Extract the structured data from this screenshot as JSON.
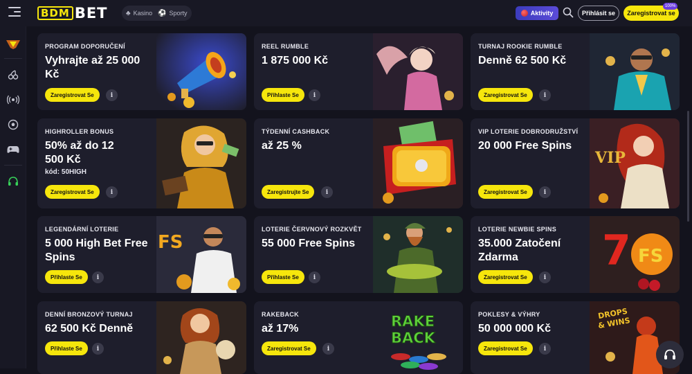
{
  "header": {
    "logo_boxed": "BDM",
    "logo_rest": "BET",
    "modes": [
      {
        "label": "Kasino",
        "icon": "casino-icon"
      },
      {
        "label": "Sporty",
        "icon": "football-icon"
      }
    ],
    "activity_label": "Aktivity",
    "login_label": "Přihlásit se",
    "register_label": "Zaregistrovat se",
    "register_badge": "100%"
  },
  "sidebar": {
    "items": [
      "rank-badge-icon",
      "cherries-icon",
      "live-icon",
      "football-icon",
      "gamepad-icon",
      "headset-icon"
    ]
  },
  "cards": [
    {
      "label": "PROGRAM DOPORUČENÍ",
      "title": "Vyhrajte až 25 000 Kč",
      "cta": "Zaregistrovat Se"
    },
    {
      "label": "REEL RUMBLE",
      "title": "1 875 000 Kč",
      "cta": "Přihlaste Se"
    },
    {
      "label": "TURNAJ ROOKIE RUMBLE",
      "title": "Denně 62 500 Kč",
      "cta": "Zaregistrovat Se"
    },
    {
      "label": "HIGHROLLER BONUS",
      "title": "50% až do 12 500 Kč",
      "code": "kód: 50HIGH",
      "cta": "Zaregistrovat Se"
    },
    {
      "label": "TÝDENNÍ CASHBACK",
      "title": "až 25 %",
      "cta": "Zaregistrujte Se"
    },
    {
      "label": "VIP LOTERIE DOBRODRUŽSTVÍ",
      "title": "20 000 Free Spins",
      "cta": "Zaregistrovat Se"
    },
    {
      "label": "LEGENDÁRNÍ LOTERIE",
      "title": "5 000 High Bet Free Spins",
      "cta": "Přihlaste Se"
    },
    {
      "label": "LOTERIE ČERVNOVÝ ROZKVĚT",
      "title": "55 000 Free Spins",
      "cta": "Přihlaste Se"
    },
    {
      "label": "LOTERIE NEWBIE SPINS",
      "title": "35.000 Zatočení Zdarma",
      "cta": "Zaregistrovat Se"
    },
    {
      "label": "DENNÍ BRONZOVÝ TURNAJ",
      "title": "62 500 Kč Denně",
      "cta": "Přihlaste Se"
    },
    {
      "label": "RAKEBACK",
      "title": "až 17%",
      "cta": "Zaregistrovat Se",
      "art_text": [
        "RAKE",
        "BACK"
      ]
    },
    {
      "label": "POKLESY & VÝHRY",
      "title": "50 000 000 Kč",
      "cta": "Zaregistrovat Se",
      "art_text": [
        "DROPS",
        "& WINS"
      ]
    }
  ],
  "info_glyph": "i",
  "colors": {
    "accent": "#f6e60c",
    "card_bg": "#1e1e2c",
    "page_bg": "#13131d",
    "activity": "#4a44d0"
  }
}
